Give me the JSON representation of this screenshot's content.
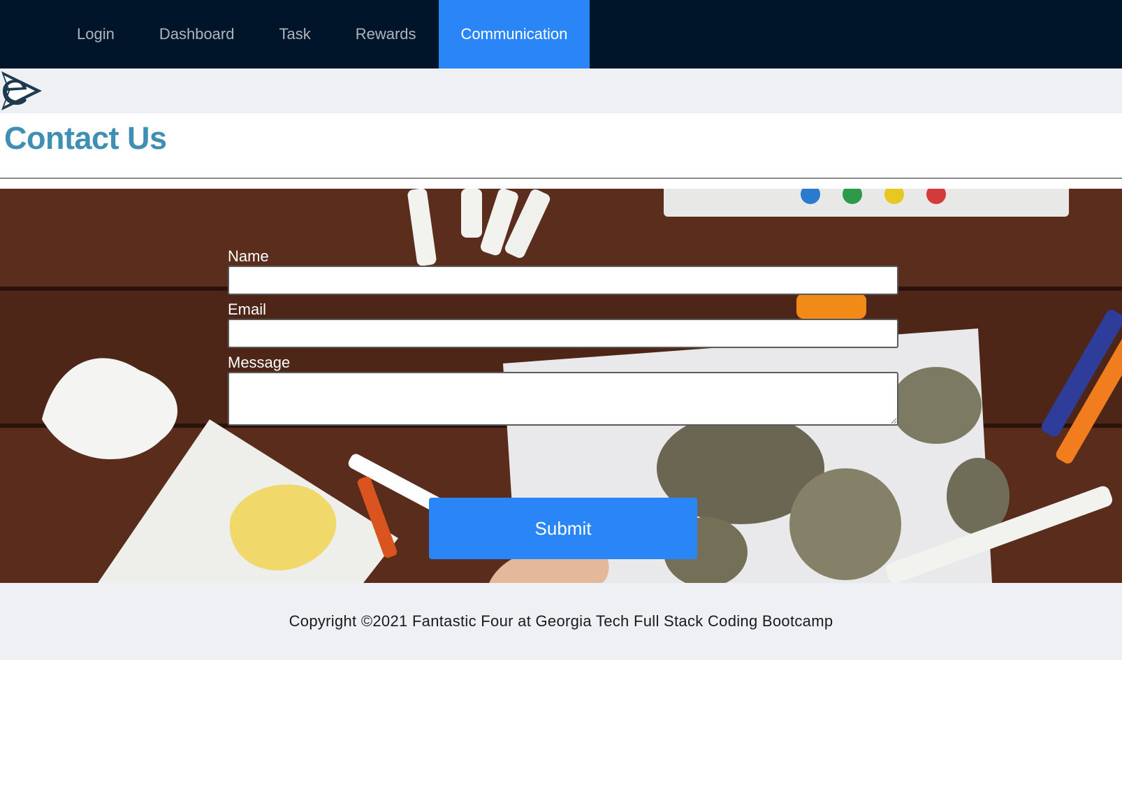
{
  "nav": {
    "items": [
      {
        "label": "Login"
      },
      {
        "label": "Dashboard"
      },
      {
        "label": "Task"
      },
      {
        "label": "Rewards"
      },
      {
        "label": "Communication"
      }
    ],
    "active_index": 4,
    "active_color": "#2a86f7",
    "background": "#001529"
  },
  "logo": {
    "icon": "e-arrow-logo"
  },
  "page": {
    "title": "Contact Us",
    "title_color": "#3f8fb5"
  },
  "form": {
    "name_label": "Name",
    "name_value": "",
    "email_label": "Email",
    "email_value": "",
    "message_label": "Message",
    "message_value": "",
    "submit_label": "Submit"
  },
  "footer": {
    "text": "Copyright ©2021 Fantastic Four at Georgia Tech Full Stack Coding Bootcamp"
  }
}
